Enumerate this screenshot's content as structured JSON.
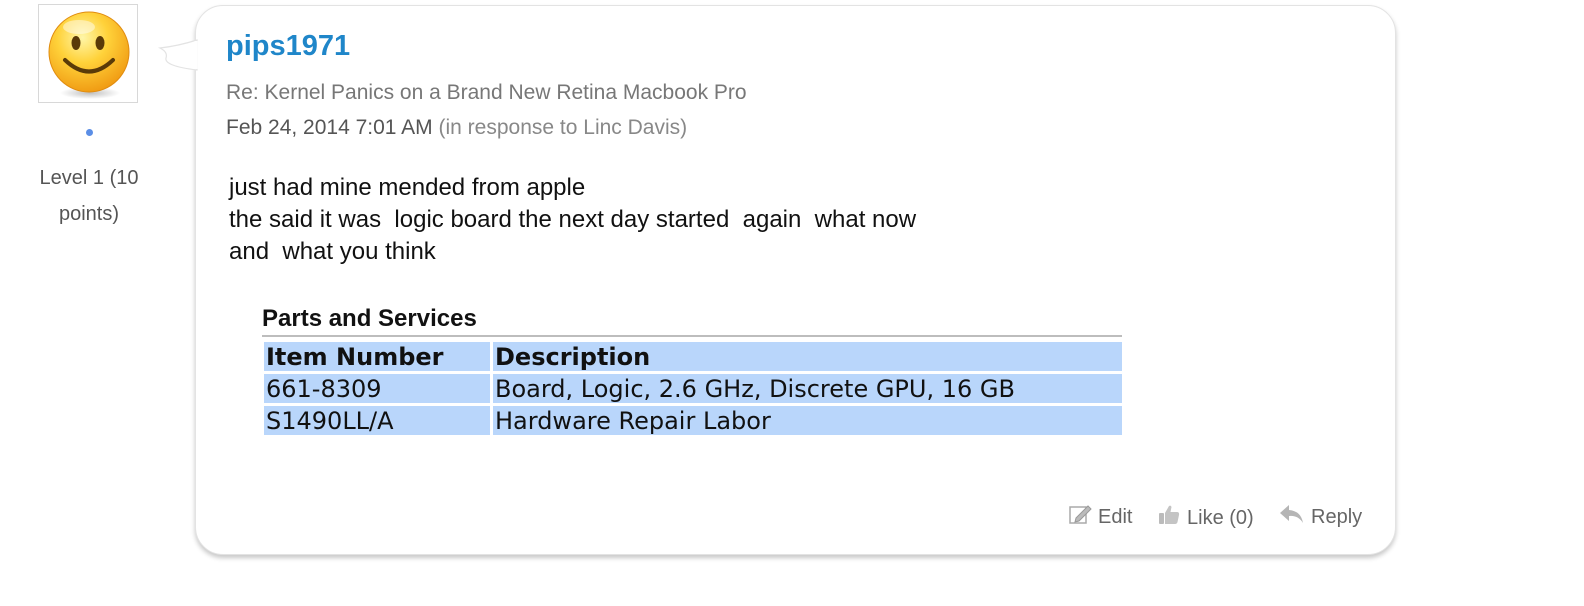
{
  "author": {
    "name": "pips1971",
    "level": "Level 1 (10 points)",
    "avatar_icon": "smiley-face-icon"
  },
  "post": {
    "subject": "Re: Kernel Panics on a Brand New Retina Macbook Pro",
    "date": "Feb 24, 2014 7:01 AM",
    "paren_open": "(",
    "in_response_label": "in response to",
    "in_response_to": "Linc Davis",
    "paren_close": ")",
    "body": "just had mine mended from apple\nthe said it was  logic board the next day started  again  what now\nand  what you think"
  },
  "parts": {
    "title": "Parts and Services",
    "headers": [
      "Item Number",
      "Description"
    ],
    "rows": [
      [
        "661-8309",
        "Board, Logic, 2.6 GHz, Discrete GPU, 16 GB"
      ],
      [
        "S1490LL/A",
        "Hardware Repair Labor"
      ]
    ],
    "cell_color": "#b9d6fb"
  },
  "actions": {
    "edit_label": "Edit",
    "like_label": "Like (0)",
    "reply_label": "Reply",
    "edit_icon": "edit-pencil-icon",
    "like_icon": "thumbs-up-icon",
    "reply_icon": "reply-arrow-icon"
  },
  "colors": {
    "author_link": "#1f86c9",
    "status_dot": "#5b8ee6"
  }
}
